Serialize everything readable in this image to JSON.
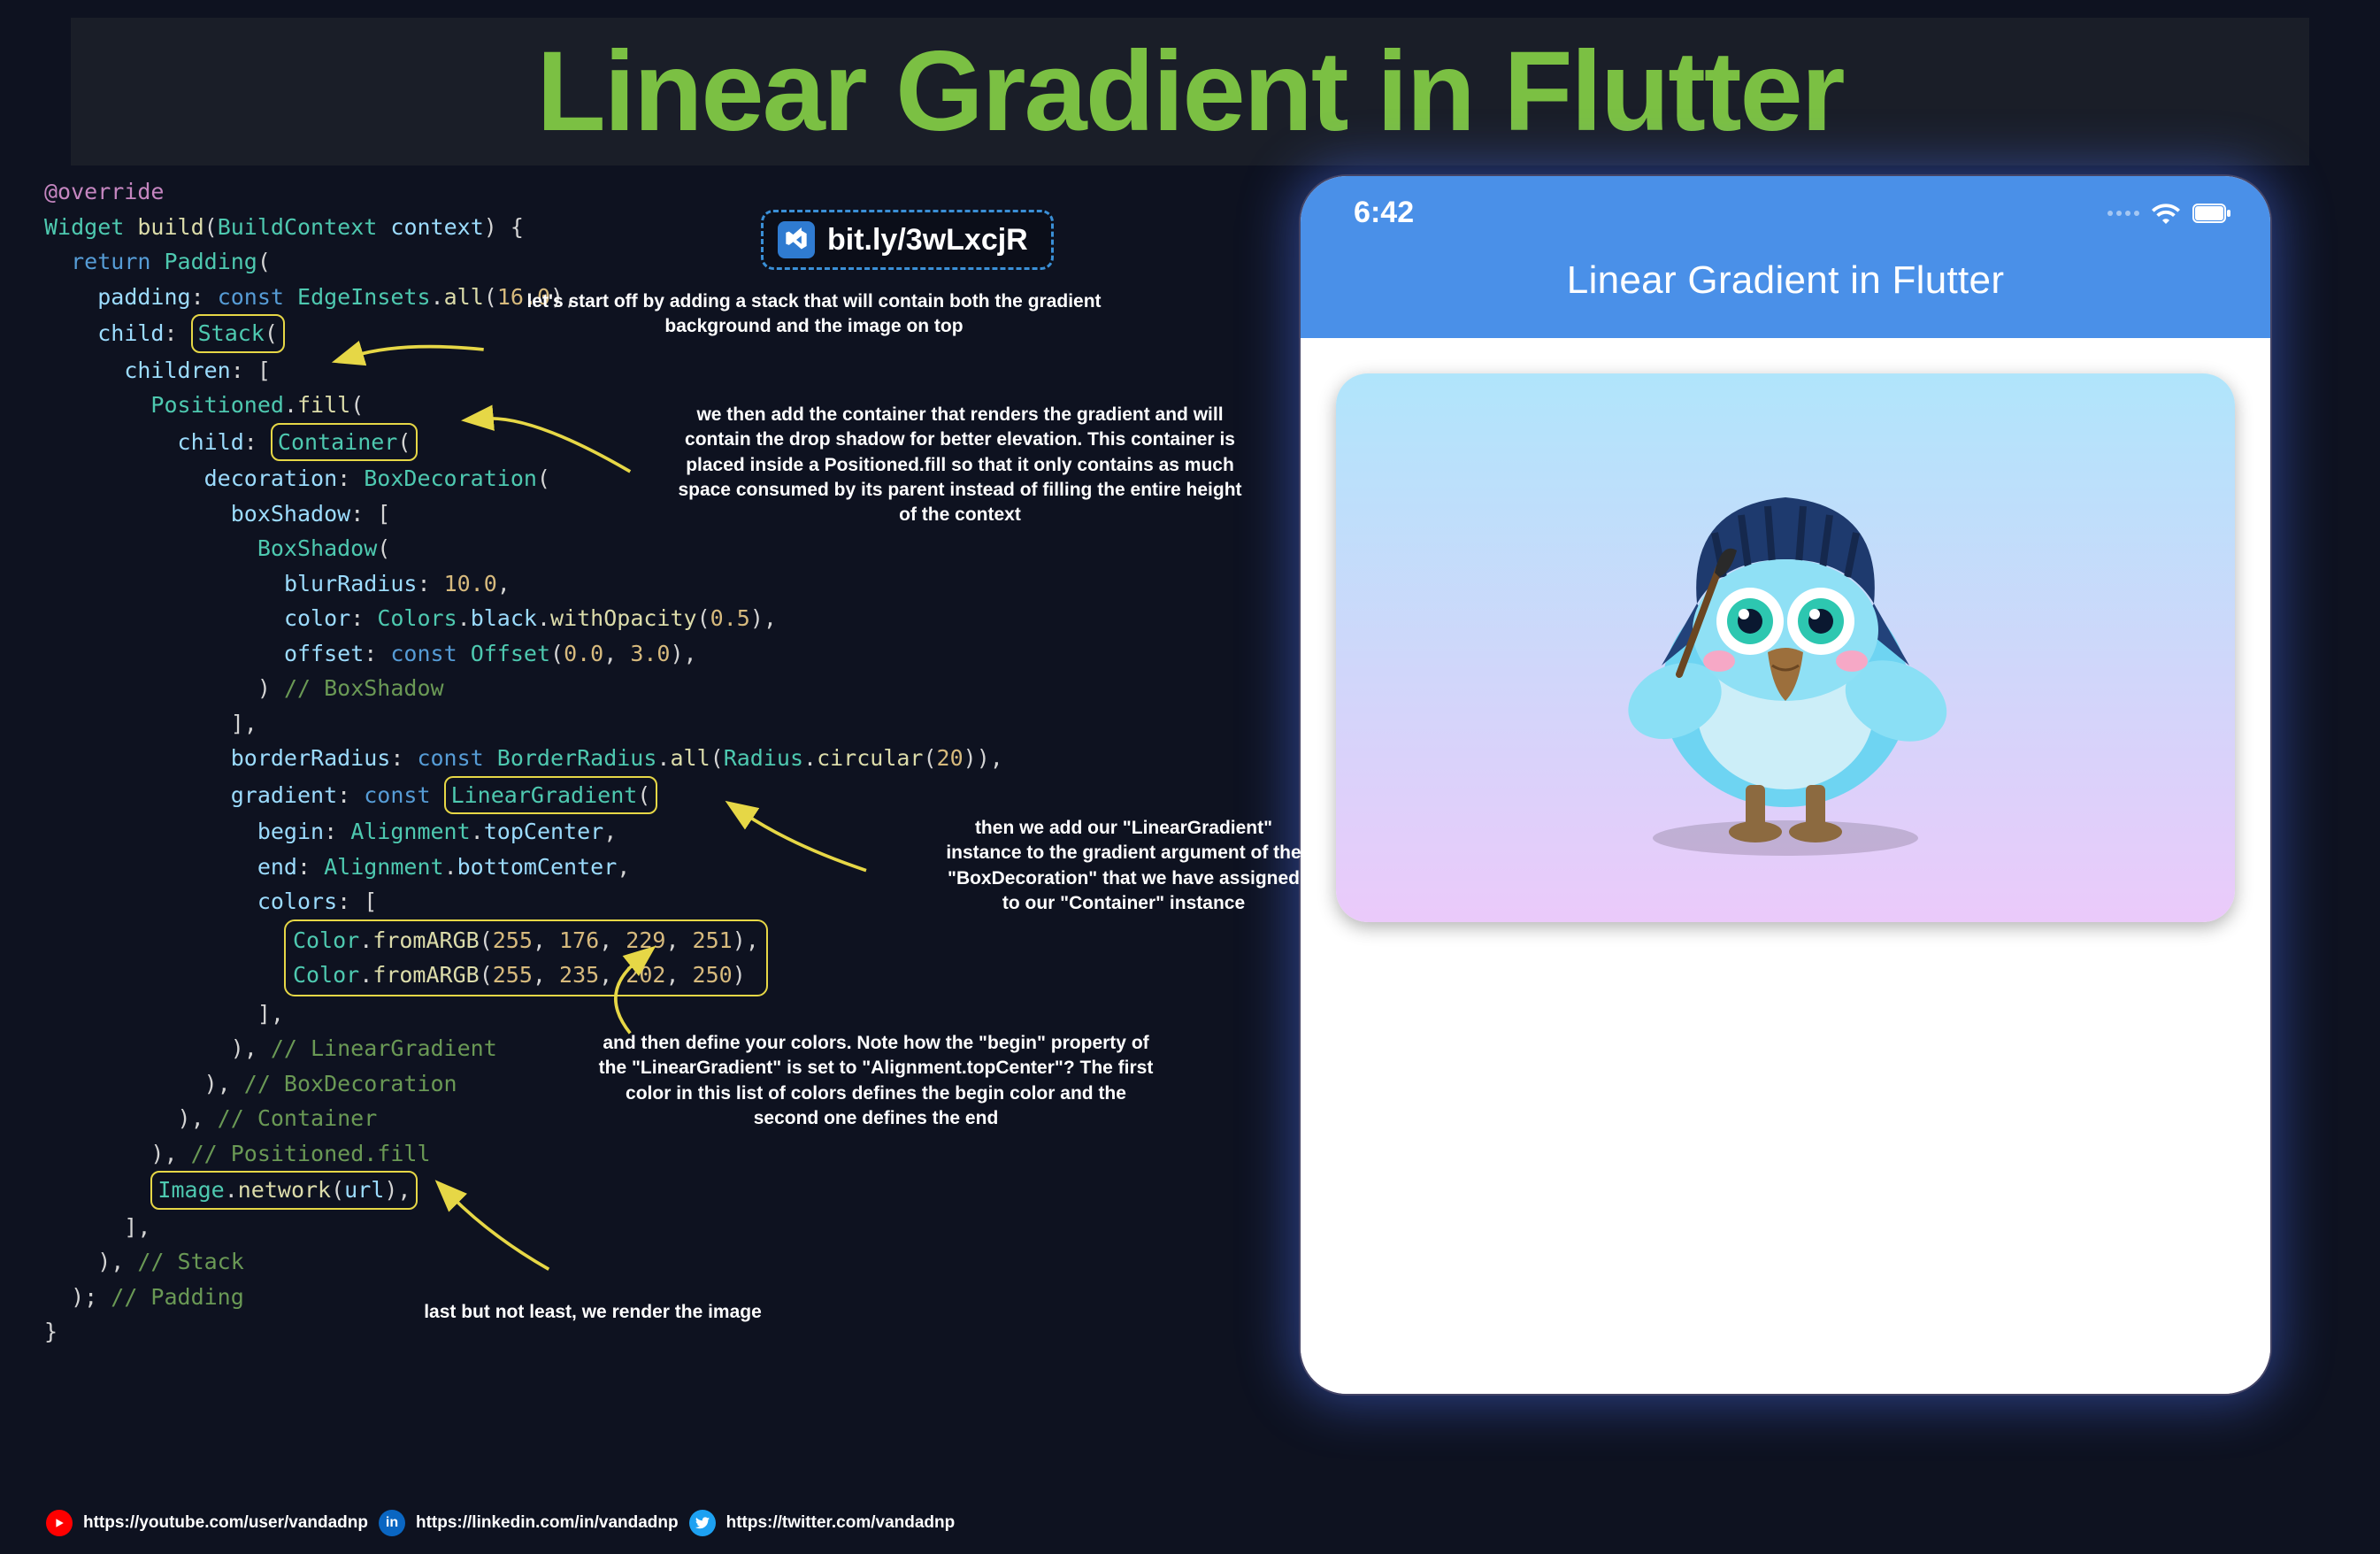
{
  "title": "Linear Gradient in Flutter",
  "bitly": {
    "label": "bit.ly/3wLxcjR"
  },
  "notes": {
    "stack": "let's start off by adding a stack that will contain both the gradient background and the image on top",
    "container": "we then add the container that renders the gradient and will contain the drop shadow for better elevation. This container is placed inside a Positioned.fill so that it only contains as much space consumed by its parent instead of filling the entire height of the context",
    "lineargrad": "then we add our \"LinearGradient\" instance to the gradient argument of the \"BoxDecoration\" that we have assigned to our \"Container\" instance",
    "colors": "and then define your colors. Note how the \"begin\" property of the \"LinearGradient\" is set to \"Alignment.topCenter\"? The first color in this list of colors defines the begin color and the second one defines the end",
    "image": "last but not least, we render the image"
  },
  "code": {
    "override": "@override",
    "widget": "Widget",
    "build": "build",
    "buildcontext": "BuildContext",
    "context": "context",
    "return": "return",
    "padding_cls": "Padding",
    "padding_prop": "padding",
    "const": "const",
    "edgeinsets": "EdgeInsets",
    "all": "all",
    "sixteen": "16.0",
    "child": "child",
    "stack": "Stack",
    "children": "children",
    "positioned": "Positioned",
    "fill": "fill",
    "container": "Container",
    "decoration": "decoration",
    "boxdecoration": "BoxDecoration",
    "boxshadow": "boxShadow",
    "boxshadow_cls": "BoxShadow",
    "blurradius": "blurRadius",
    "ten": "10.0",
    "color_prop": "color",
    "colors_cls": "Colors",
    "black": "black",
    "withopacity": "withOpacity",
    "half": "0.5",
    "offset_prop": "offset",
    "offset_cls": "Offset",
    "zero": "0.0",
    "three": "3.0",
    "boxshadow_cmt": "// BoxShadow",
    "borderradius": "borderRadius",
    "borderradius_cls": "BorderRadius",
    "radius_cls": "Radius",
    "circular": "circular",
    "twenty": "20",
    "gradient_prop": "gradient",
    "lineargradient_cls": "LinearGradient",
    "begin_prop": "begin",
    "alignment_cls": "Alignment",
    "topcenter": "topCenter",
    "end_prop": "end",
    "bottomcenter": "bottomCenter",
    "colors_prop": "colors",
    "color_cls": "Color",
    "fromargb": "fromARGB",
    "c1a": "255",
    "c1b": "176",
    "c1c": "229",
    "c1d": "251",
    "c2a": "255",
    "c2b": "235",
    "c2c": "202",
    "c2d": "250",
    "lg_cmt": "// LinearGradient",
    "bd_cmt": "// BoxDecoration",
    "ct_cmt": "// Container",
    "pf_cmt": "// Positioned.fill",
    "image_cls": "Image",
    "network": "network",
    "url": "url",
    "stack_cmt": "// Stack",
    "pad_cmt": "// Padding"
  },
  "phone": {
    "time": "6:42",
    "appbar_title": "Linear Gradient in Flutter",
    "card_gradient_start": "#b0e5fb",
    "card_gradient_end": "#ebcafa"
  },
  "socials": {
    "youtube": "https://youtube.com/user/vandadnp",
    "linkedin": "https://linkedin.com/in/vandadnp",
    "twitter": "https://twitter.com/vandadnp"
  }
}
